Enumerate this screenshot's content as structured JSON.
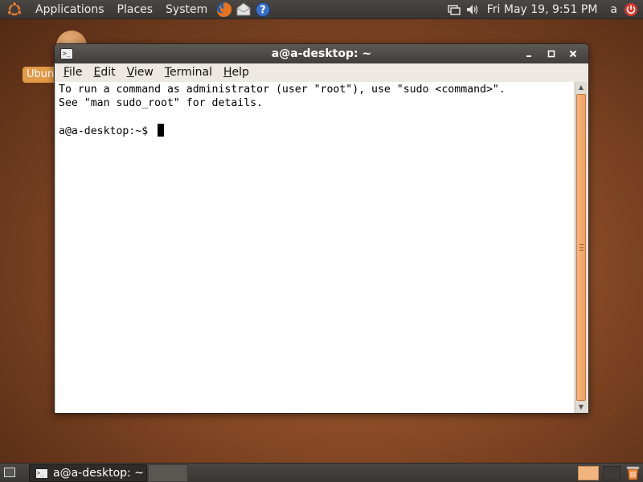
{
  "top_panel": {
    "menus": [
      "Applications",
      "Places",
      "System"
    ],
    "clock": "Fri May 19,  9:51 PM",
    "user": "a",
    "icons": [
      "ubuntu-logo-icon",
      "firefox-icon",
      "mail-icon",
      "help-icon",
      "network-icon",
      "volume-icon",
      "power-icon"
    ]
  },
  "desktop": {
    "icon_label": "Ubuntu"
  },
  "window": {
    "title": "a@a-desktop: ~",
    "menu": [
      "File",
      "Edit",
      "View",
      "Terminal",
      "Help"
    ],
    "terminal_lines": [
      "To run a command as administrator (user \"root\"), use \"sudo <command>\".",
      "See \"man sudo_root\" for details.",
      "",
      "a@a-desktop:~$ "
    ]
  },
  "bottom_panel": {
    "task_label": "a@a-desktop: ~",
    "workspace_count": 2,
    "active_workspace": 1
  },
  "colors": {
    "panel": "#3f3b38",
    "accent": "#f0a062",
    "desktop": "#94522a"
  }
}
